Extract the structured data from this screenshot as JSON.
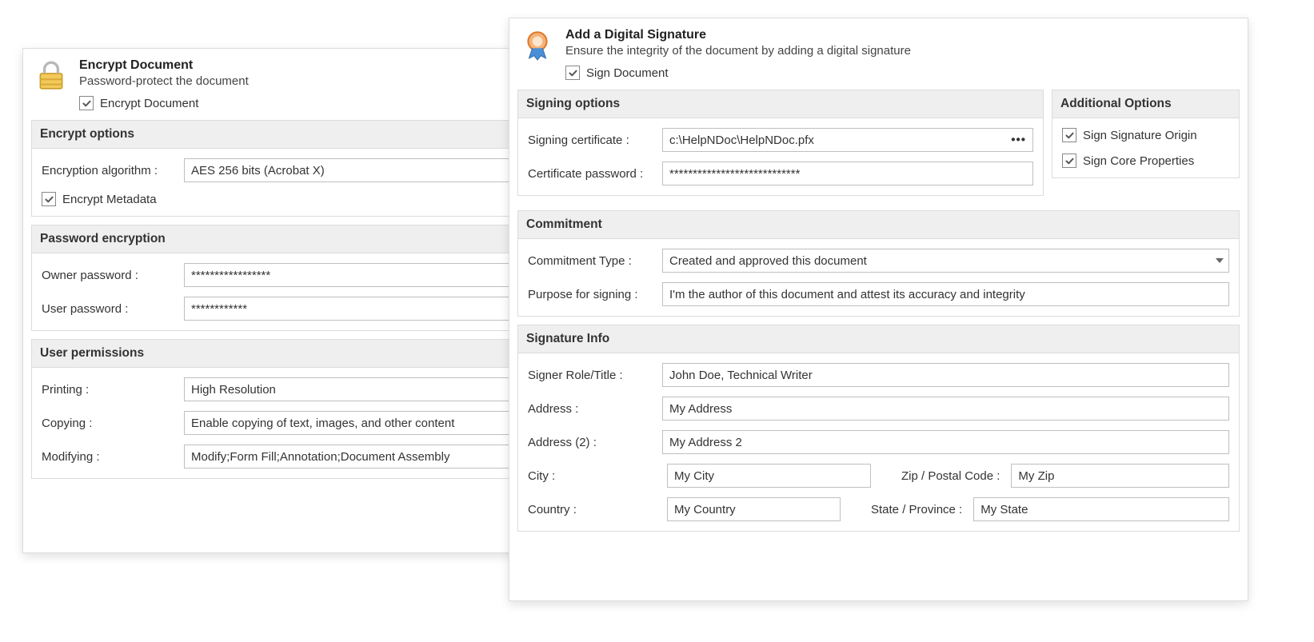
{
  "encrypt": {
    "title": "Encrypt Document",
    "subtitle": "Password-protect the document",
    "master_checkbox_label": "Encrypt Document",
    "master_checked": true,
    "options_header": "Encrypt options",
    "algo_label": "Encryption algorithm :",
    "algo_value": "AES 256 bits (Acrobat X)",
    "encrypt_metadata_label": "Encrypt Metadata",
    "encrypt_metadata_checked": true,
    "password_header": "Password encryption",
    "owner_pw_label": "Owner password :",
    "owner_pw_value": "*****************",
    "user_pw_label": "User password :",
    "user_pw_value": "************",
    "permissions_header": "User permissions",
    "printing_label": "Printing :",
    "printing_value": "High Resolution",
    "copying_label": "Copying :",
    "copying_value": "Enable copying of text, images, and other content",
    "modifying_label": "Modifying :",
    "modifying_value": "Modify;Form Fill;Annotation;Document Assembly"
  },
  "signature": {
    "title": "Add a Digital Signature",
    "subtitle": "Ensure the integrity of the document by adding a digital signature",
    "master_checkbox_label": "Sign Document",
    "master_checked": true,
    "signing_header": "Signing options",
    "cert_label": "Signing certificate :",
    "cert_value": "c:\\HelpNDoc\\HelpNDoc.pfx",
    "cert_pw_label": "Certificate password :",
    "cert_pw_value": "****************************",
    "additional_header": "Additional Options",
    "sign_origin_label": "Sign Signature Origin",
    "sign_origin_checked": true,
    "sign_core_label": "Sign Core Properties",
    "sign_core_checked": true,
    "commitment_header": "Commitment",
    "commit_type_label": "Commitment Type :",
    "commit_type_value": "Created and approved this document",
    "purpose_label": "Purpose for signing :",
    "purpose_value": "I'm the author of this document and attest its accuracy and integrity",
    "info_header": "Signature Info",
    "role_label": "Signer Role/Title :",
    "role_value": "John Doe, Technical Writer",
    "address_label": "Address :",
    "address_value": "My Address",
    "address2_label": "Address (2) :",
    "address2_value": "My Address 2",
    "city_label": "City :",
    "city_value": "My City",
    "zip_label": "Zip / Postal Code :",
    "zip_value": "My Zip",
    "country_label": "Country :",
    "country_value": "My Country",
    "state_label": "State / Province :",
    "state_value": "My State"
  }
}
